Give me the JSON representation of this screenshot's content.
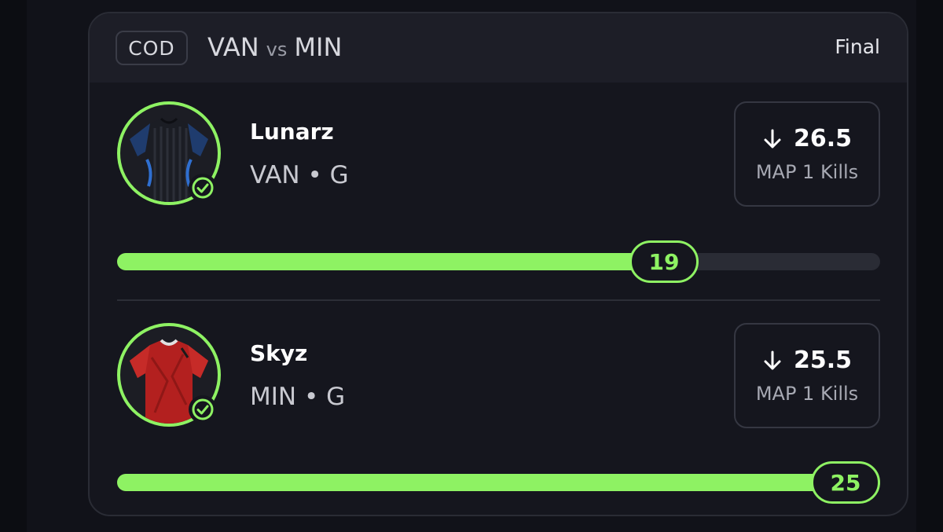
{
  "header": {
    "league": "COD",
    "home_team": "VAN",
    "vs": "vs",
    "away_team": "MIN",
    "status": "Final"
  },
  "colors": {
    "accent": "#8ef263",
    "card_bg": "#15161e",
    "header_bg": "#1d1e27",
    "track": "#2a2c35"
  },
  "players": [
    {
      "name": "Lunarz",
      "team": "VAN",
      "separator": "•",
      "position": "G",
      "direction_icon": "arrow-down-icon",
      "line": "26.5",
      "stat_label": "MAP 1 Kills",
      "actual": "19",
      "progress_fraction": 0.717,
      "jersey": "black-blue-jersey",
      "status_icon": "check-circle-icon"
    },
    {
      "name": "Skyz",
      "team": "MIN",
      "separator": "•",
      "position": "G",
      "direction_icon": "arrow-down-icon",
      "line": "25.5",
      "stat_label": "MAP 1 Kills",
      "actual": "25",
      "progress_fraction": 1.0,
      "jersey": "red-jersey",
      "status_icon": "check-circle-icon"
    }
  ]
}
